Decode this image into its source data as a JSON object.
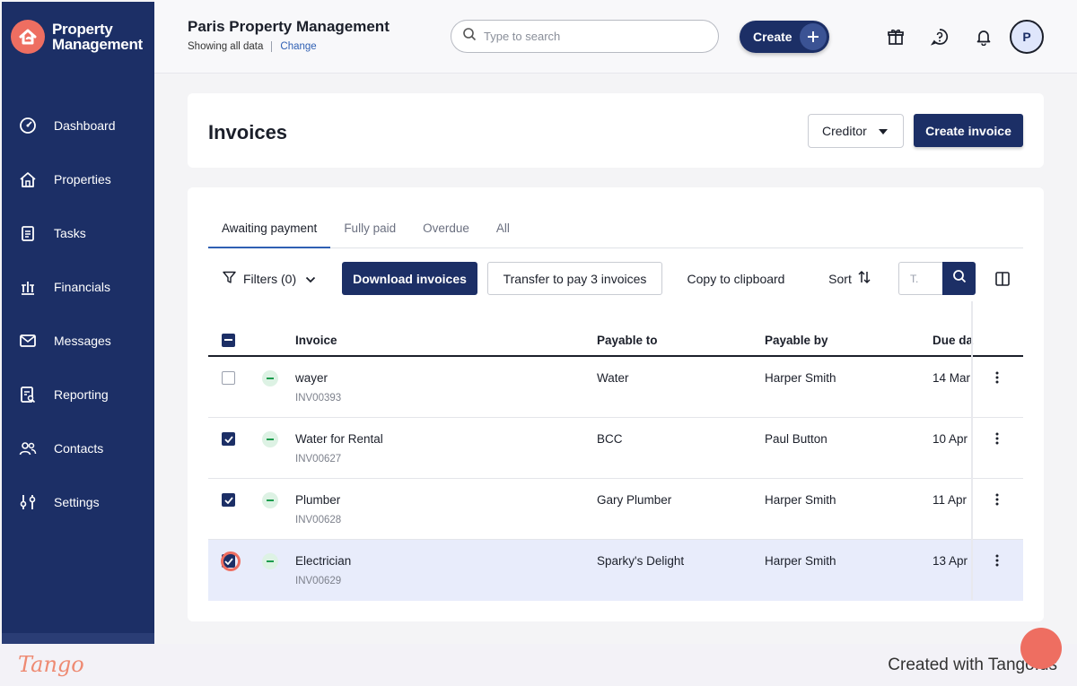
{
  "brand": {
    "line1": "Property",
    "line2": "Management"
  },
  "sidebar": {
    "items": [
      {
        "label": "Dashboard",
        "icon": "dashboard-icon"
      },
      {
        "label": "Properties",
        "icon": "home-icon"
      },
      {
        "label": "Tasks",
        "icon": "clipboard-icon"
      },
      {
        "label": "Financials",
        "icon": "bank-icon"
      },
      {
        "label": "Messages",
        "icon": "mail-icon"
      },
      {
        "label": "Reporting",
        "icon": "report-icon"
      },
      {
        "label": "Contacts",
        "icon": "people-icon"
      },
      {
        "label": "Settings",
        "icon": "sliders-icon"
      }
    ]
  },
  "header": {
    "org_title": "Paris Property Management",
    "showing": "Showing all data",
    "change": "Change",
    "search_placeholder": "Type to search",
    "create_label": "Create",
    "avatar_initial": "P"
  },
  "page": {
    "title": "Invoices",
    "creditor_label": "Creditor",
    "create_invoice_label": "Create invoice"
  },
  "tabs": [
    "Awaiting payment",
    "Fully paid",
    "Overdue",
    "All"
  ],
  "toolbar": {
    "filters_label": "Filters (0)",
    "download_label": "Download invoices",
    "transfer_label": "Transfer to pay 3 invoices",
    "copy_label": "Copy to clipboard",
    "sort_label": "Sort",
    "mini_search_placeholder": "T."
  },
  "table": {
    "columns": [
      "Invoice",
      "Payable to",
      "Payable by",
      "Due da"
    ],
    "rows": [
      {
        "invoice": "wayer",
        "number": "INV00393",
        "payable_to": "Water",
        "payable_by": "Harper Smith",
        "due": "14 Mar",
        "checked": false
      },
      {
        "invoice": "Water for Rental",
        "number": "INV00627",
        "payable_to": "BCC",
        "payable_by": "Paul Button",
        "due": "10 Apr",
        "checked": true
      },
      {
        "invoice": "Plumber",
        "number": "INV00628",
        "payable_to": "Gary Plumber",
        "payable_by": "Harper Smith",
        "due": "11 Apr",
        "checked": true
      },
      {
        "invoice": "Electrician",
        "number": "INV00629",
        "payable_to": "Sparky's Delight",
        "payable_by": "Harper Smith",
        "due": "13 Apr",
        "checked": true
      }
    ]
  },
  "footer": {
    "logo": "Tango",
    "credit": "Created with Tango.us"
  },
  "colors": {
    "navy": "#1c2f66",
    "accent": "#ee6e61",
    "link": "#2f5fb3",
    "status_green": "#1c9c4e",
    "row_highlight": "#e8ecfb"
  }
}
